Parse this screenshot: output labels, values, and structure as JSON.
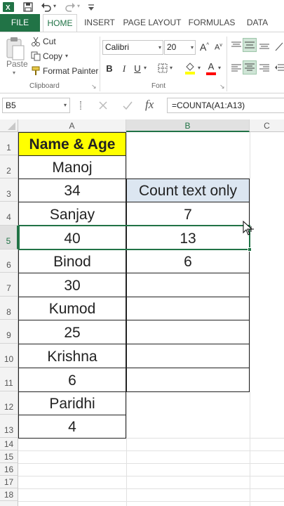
{
  "titlebar": {
    "icons": [
      "excel-logo-icon",
      "save-icon",
      "undo-icon",
      "redo-icon",
      "customize-icon"
    ]
  },
  "tabs": [
    {
      "label": "FILE"
    },
    {
      "label": "HOME"
    },
    {
      "label": "INSERT"
    },
    {
      "label": "PAGE LAYOUT"
    },
    {
      "label": "FORMULAS"
    },
    {
      "label": "DATA"
    }
  ],
  "ribbon": {
    "clipboard": {
      "paste": "Paste",
      "cut": "Cut",
      "copy": "Copy",
      "format_painter": "Format Painter",
      "group_label": "Clipboard"
    },
    "font": {
      "font_name": "Calibri",
      "font_size": "20",
      "grow": "A",
      "shrink": "A",
      "bold": "B",
      "italic": "I",
      "underline": "U",
      "font_color_letter": "A",
      "group_label": "Font"
    }
  },
  "formula_bar": {
    "name_box": "B5",
    "fx": "fx",
    "formula": "=COUNTA(A1:A13)"
  },
  "grid": {
    "columns": [
      "A",
      "B",
      "C"
    ],
    "rows": [
      "1",
      "2",
      "3",
      "4",
      "5",
      "6",
      "7",
      "8",
      "9",
      "10",
      "11",
      "12",
      "13",
      "14",
      "15",
      "16",
      "17",
      "18"
    ],
    "col_a": [
      "Name & Age",
      "Manoj",
      "34",
      "Sanjay",
      "40",
      "Binod",
      "30",
      "Kumod",
      "25",
      "Krishna",
      "6",
      "Paridhi",
      "4"
    ],
    "col_b": {
      "b3": "Count text only",
      "b4": "7",
      "b5": "13",
      "b6": "6"
    }
  },
  "colors": {
    "accent": "#217346",
    "header_fill": "#ffff00",
    "label_fill": "#dce6f1"
  }
}
